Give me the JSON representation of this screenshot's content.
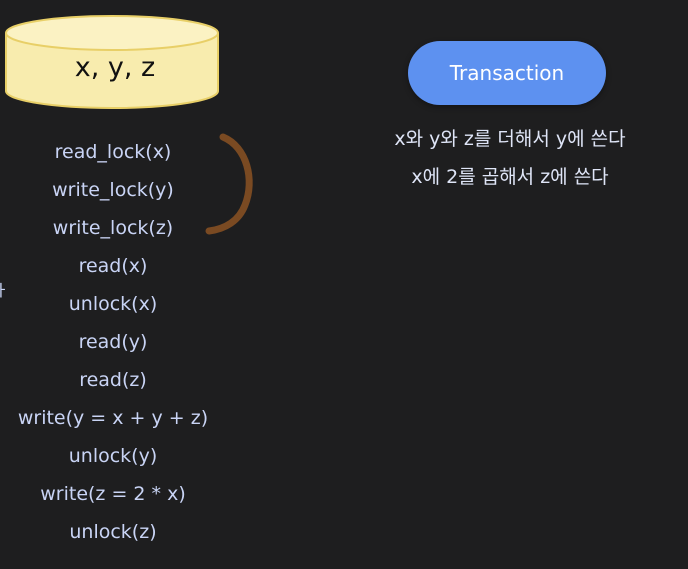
{
  "database": {
    "label": "x, y, z",
    "fill_color": "#f8ecae",
    "stroke_color": "#e8cf67"
  },
  "operations": [
    "read_lock(x)",
    "write_lock(y)",
    "write_lock(z)",
    "read(x)",
    "unlock(x)",
    "read(y)",
    "read(z)",
    "write(y = x + y + z)",
    "unlock(y)",
    "write(z = 2 * x)",
    "unlock(z)"
  ],
  "side_mark": "ㅏ",
  "transaction": {
    "label": "Transaction",
    "color": "#5d91f0"
  },
  "description": [
    "x와 y와 z를 더해서 y에 쓴다",
    "x에 2를 곱해서 z에 쓴다"
  ],
  "brace_color": "#7a4a22"
}
